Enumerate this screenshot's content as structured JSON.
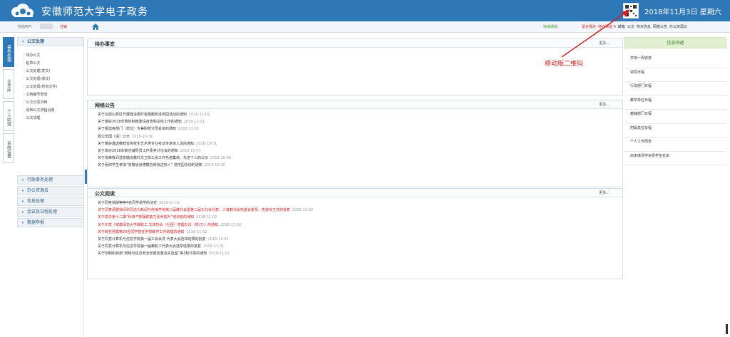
{
  "header": {
    "app_title": "安徽师范大学电子政务",
    "date": "2018年11月3日  星期六"
  },
  "subbar": {
    "user_label": "当前用户:",
    "logout": "注销",
    "quick_label": "快速通道:",
    "quick_links": [
      {
        "label": "留言督办",
        "red": true
      },
      {
        "label": "待办事宜 0",
        "red": true
      },
      {
        "label": "邮箱",
        "red": false
      },
      {
        "label": "公文",
        "red": false
      },
      {
        "label": "校对信息",
        "red": false
      },
      {
        "label": "网络公告",
        "red": false
      },
      {
        "label": "办公资源云",
        "red": false
      }
    ]
  },
  "vtabs": [
    "事务处理",
    "文件库",
    "个人助理",
    "系统设置"
  ],
  "leftnav": {
    "open_header": "公文处理",
    "items": [
      "待办公文",
      "起草公文",
      "公文处理(发文)",
      "公文处理(收文)",
      "公文处理(所有文件)",
      "文档编号查询",
      "公文分发归档",
      "退转公文流程设置",
      "公文清理"
    ],
    "collapsed": [
      "行政事务处理",
      "办公资源云",
      "信息处理",
      "会议及日程处理",
      "数据申报"
    ]
  },
  "panels": {
    "todo": {
      "title": "待办事宜",
      "more": "更多..."
    },
    "notice": {
      "title": "网络公告",
      "more": "更多...",
      "rows": [
        {
          "text": "关于在建山校区开展建设银行金融服务进校园活动的通知",
          "date": "2018-11-02"
        },
        {
          "text": "关于做好2018年我校制度建设自查和总结工作的通知",
          "date": "2018-11-01"
        },
        {
          "text": "关于报送各部门（单位）专兼职统计员名单的通知",
          "date": "2018-11-01"
        },
        {
          "text": "固公出国（境）公示",
          "date": "2018-10-31"
        },
        {
          "text": "关于做好遴选推荐省高校生艺术类专业考试专家库人选的通知",
          "date": "2018-10-31"
        },
        {
          "text": "关于举办2018年新任辅导员工作素养讨论会的通知",
          "date": "2018-10-31"
        },
        {
          "text": "关于拟推荐评选安徽省教科文卫体工会工作先进集体，先进个人的公示",
          "date": "2018-10-30"
        },
        {
          "text": "关于组织学生参加“安徽省道德模范和身边好人” 进校园活动的通知",
          "date": "2018-10-30"
        }
      ]
    },
    "doc": {
      "title": "公文阅读",
      "more": "更多...",
      "rows": [
        {
          "text": "关于同意徐皖等等4名同学退学的决定",
          "date": "2018-11-02",
          "red": false
        },
        {
          "text": "关于同意调整徐师科同志为新闻与传播学院第二届教代会暨第二届工代会代表，二级教代会执委会委员，执委会主任的批复",
          "date": "2018-11-02",
          "red": true
        },
        {
          "text": "关于举办第十二期“科级干部履职能力素养提升”培训班的通知",
          "date": "2018-11-02",
          "red": true
        },
        {
          "text": "关于印发《安徽师范大学教职工 文体协会（社团）管理办法（修订）》的通知",
          "date": "2018-11-02",
          "red": true
        },
        {
          "text": "关于聘任杨露等20名同学担任学校教学工作助理的通知",
          "date": "2018-11-02",
          "red": true
        },
        {
          "text": "关于同意计算机与信息学院第一届工会会员 代表大会选举结果的批复",
          "date": "2018-11-01",
          "red": false
        },
        {
          "text": "关于同意计算机与信息学院第一届教职工代表大会选举结果的批复",
          "date": "2018-11-01",
          "red": false
        },
        {
          "text": "关于刻制和启用“网络与信息安全安徽省重点实验室”等3枚印章的通知",
          "date": "2018-11-01",
          "red": false
        }
      ]
    }
  },
  "right": {
    "title": "信息快递",
    "items": [
      "学校一周安排",
      "领导日程",
      "行政部门日程",
      "教学单位日程",
      "教辅部门日程",
      "附属单位日程",
      "个人工作周表",
      "尚未缴清学杂费学生名单"
    ]
  },
  "annotation": "移动版二维码",
  "colors": {
    "header_bg": "#2f78b7",
    "accent_red": "#d02020",
    "quick_green": "#3a9a2a"
  }
}
